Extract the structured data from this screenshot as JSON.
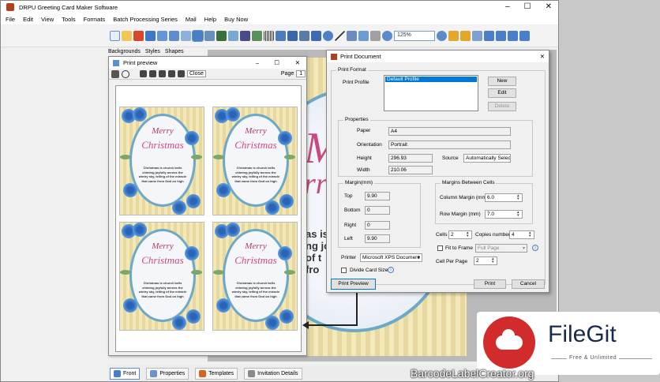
{
  "app": {
    "title": "DRPU Greeting Card Maker Software",
    "menu": [
      "File",
      "Edit",
      "View",
      "Tools",
      "Formats",
      "Batch Processing Series",
      "Mail",
      "Help",
      "Buy Now"
    ],
    "zoom": "125%",
    "left_tabs": [
      "Backgrounds",
      "Styles",
      "Shapes"
    ],
    "bottom_tabs": [
      "Front",
      "Properties",
      "Templates",
      "Invitation Details"
    ],
    "canvas_text": [
      "Me",
      "rri",
      "as is",
      "ng joy",
      "of t",
      "fro"
    ]
  },
  "print_preview": {
    "title": "Print preview",
    "close_label": "Close",
    "page_label": "Page",
    "page_value": "1",
    "card": {
      "line1": "Merry",
      "line2": "Christmas",
      "body": "Christmas is church bells chiming joyfully across the wintry sky, telling of the miracle that came from God on high"
    }
  },
  "print_document": {
    "title": "Print Document",
    "print_format_label": "Print Format",
    "print_profile_label": "Print Profile",
    "profile_selected": "Default Profile",
    "new_label": "New",
    "edit_label": "Edit",
    "delete_label": "Delete",
    "properties_label": "Properties",
    "paper_label": "Paper",
    "paper_value": "A4",
    "orientation_label": "Orientation",
    "orientation_value": "Portrait",
    "height_label": "Height",
    "height_value": "296.93",
    "width_label": "Width",
    "width_value": "210.06",
    "source_label": "Source",
    "source_value": "Automatically Select",
    "margin_label": "Margin(mm)",
    "top_label": "Top",
    "top_value": "9.90",
    "bottom_label": "Bottom",
    "bottom_value": "0",
    "right_label": "Right",
    "right_value": "0",
    "left_label": "Left",
    "left_value": "9.90",
    "margins_between_label": "Margins Between Cells",
    "column_margin_label": "Column Margin (mm)",
    "column_margin_value": "6.0",
    "row_margin_label": "Row Margin (mm)",
    "row_margin_value": "7.0",
    "cells_label": "Cells",
    "cells_value": "2",
    "copies_label": "Copies number",
    "copies_value": "4",
    "fit_label": "Fit to Frame",
    "fit_value": "Full Page",
    "cell_per_page_label": "Cell Per Page",
    "cell_per_page_value": "2",
    "printer_label": "Printer",
    "printer_value": "Microsoft XPS Document",
    "divide_label": "Divide Card Size",
    "print_preview_label": "Print Preview",
    "print_label": "Print",
    "cancel_label": "Cancel"
  },
  "watermark": {
    "brand": "FileGit",
    "tagline": "Free & Unlimited",
    "site": "BarcodeLabelCreator.org"
  }
}
